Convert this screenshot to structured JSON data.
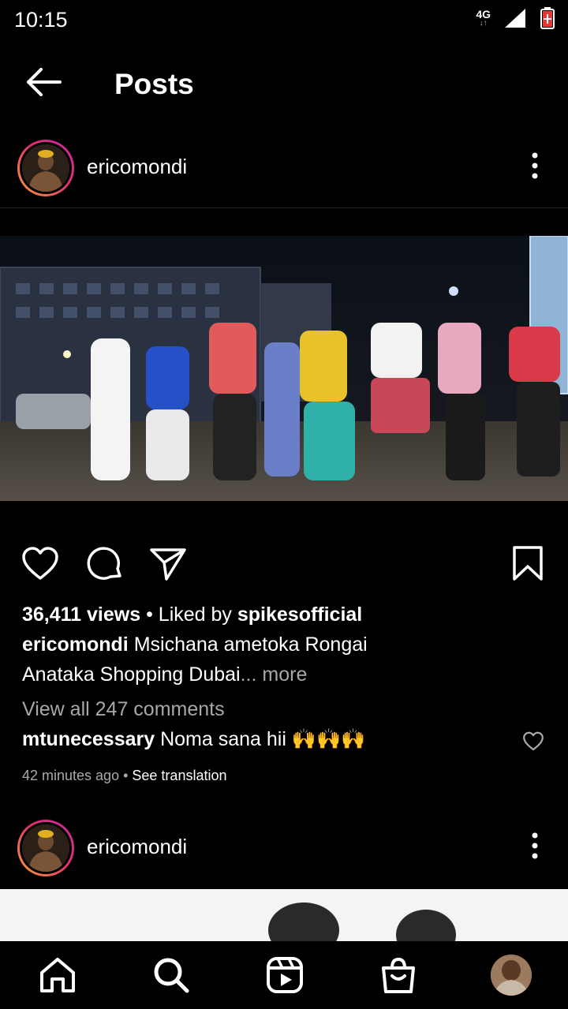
{
  "status": {
    "time": "10:15",
    "network": "4G"
  },
  "header": {
    "title": "Posts"
  },
  "post": {
    "username": "ericomondi",
    "views_count": "36,411 views",
    "liked_by_prefix": " • Liked by ",
    "liked_by_user": "spikesofficial",
    "caption_user": "ericomondi",
    "caption_line1": " Msichana ametoka Rongai",
    "caption_line2": "Anataka Shopping Dubai",
    "caption_more": "... more",
    "view_comments": "View all 247 comments",
    "comment_user": "mtunecessary",
    "comment_text": " Noma sana hii ",
    "comment_emoji": "🙌🙌🙌",
    "time_ago": "42 minutes ago",
    "meta_separator": " • ",
    "see_translation": "See translation"
  },
  "post2": {
    "username": "ericomondi"
  },
  "icons": {
    "back": "arrow-left-icon",
    "more": "more-vertical-icon",
    "like": "heart-icon",
    "comment": "comment-icon",
    "share": "send-icon",
    "save": "bookmark-icon",
    "home": "home-icon",
    "search": "search-icon",
    "reels": "reels-icon",
    "shop": "shop-icon"
  },
  "colors": {
    "background": "#000000",
    "muted": "#a8a8a8",
    "battery": "#e53935",
    "ring_start": "#f9a234",
    "ring_end": "#c32aa3"
  }
}
